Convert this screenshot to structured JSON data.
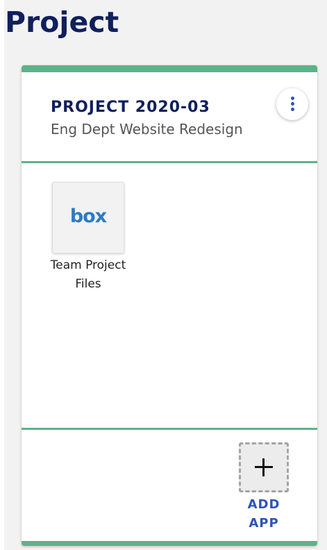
{
  "page": {
    "title": "Project"
  },
  "card": {
    "project_code": "PROJECT 2020-03",
    "project_name": "Eng Dept Website Redesign",
    "menu_icon": "kebab-menu-icon",
    "apps": [
      {
        "logo_text": "box",
        "label": "Team Project Files",
        "icon": "box-logo-icon"
      }
    ],
    "add_app": {
      "label": "ADD APP",
      "icon": "plus-icon"
    }
  },
  "colors": {
    "title": "#10205c",
    "accent_green": "#5bb38b",
    "link_blue": "#2d54b8",
    "box_blue": "#2e7bc4"
  }
}
